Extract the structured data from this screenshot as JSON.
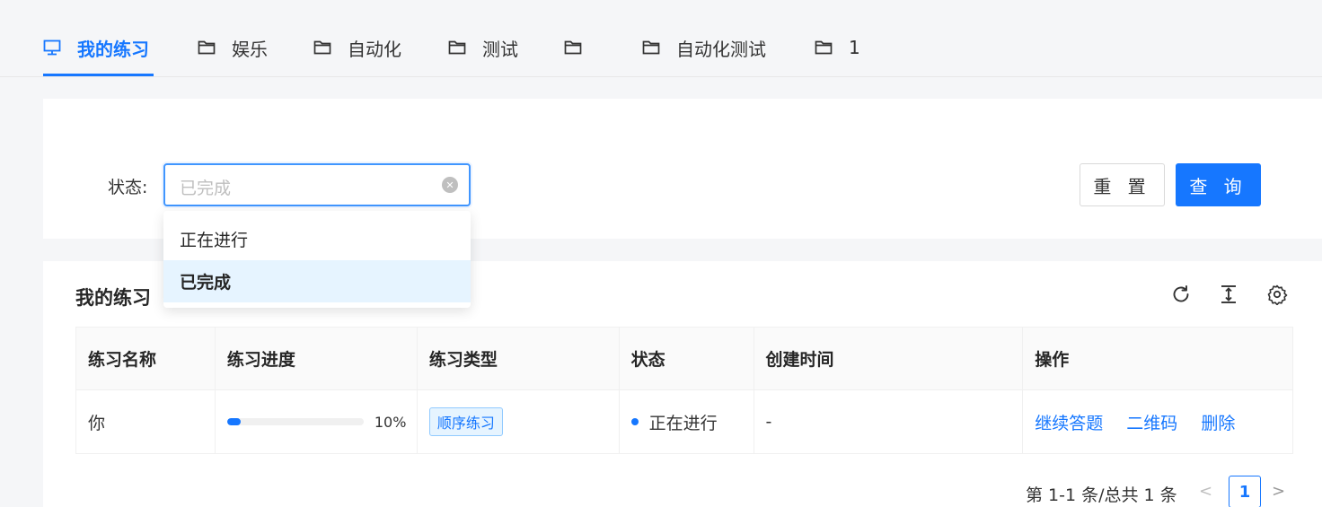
{
  "tabs": [
    {
      "label": "我的练习",
      "icon": "monitor-icon",
      "active": true
    },
    {
      "label": "娱乐",
      "icon": "folder-icon"
    },
    {
      "label": "自动化",
      "icon": "folder-icon"
    },
    {
      "label": "测试",
      "icon": "folder-icon"
    },
    {
      "label": "",
      "icon": "folder-icon"
    },
    {
      "label": "自动化测试",
      "icon": "folder-icon"
    },
    {
      "label": "1",
      "icon": "folder-icon"
    }
  ],
  "filter": {
    "status_label": "状态:",
    "status_value": "已完成",
    "reset_label": "重 置",
    "query_label": "查 询",
    "options": [
      {
        "label": "正在进行",
        "selected": false
      },
      {
        "label": "已完成",
        "selected": true
      }
    ]
  },
  "table": {
    "title": "我的练习",
    "columns": [
      "练习名称",
      "练习进度",
      "练习类型",
      "状态",
      "创建时间",
      "操作"
    ],
    "rows": [
      {
        "name": "你",
        "progress": 0.1,
        "progress_text": "10%",
        "type": "顺序练习",
        "status": "正在进行",
        "created": "-",
        "actions": [
          "继续答题",
          "二维码",
          "删除"
        ]
      }
    ]
  },
  "pagination": {
    "total_text": "第 1-1 条/总共 1 条",
    "current_page": "1",
    "prev": "<",
    "next": ">"
  },
  "colors": {
    "primary": "#1677ff",
    "selected_bg": "#e6f4ff"
  }
}
